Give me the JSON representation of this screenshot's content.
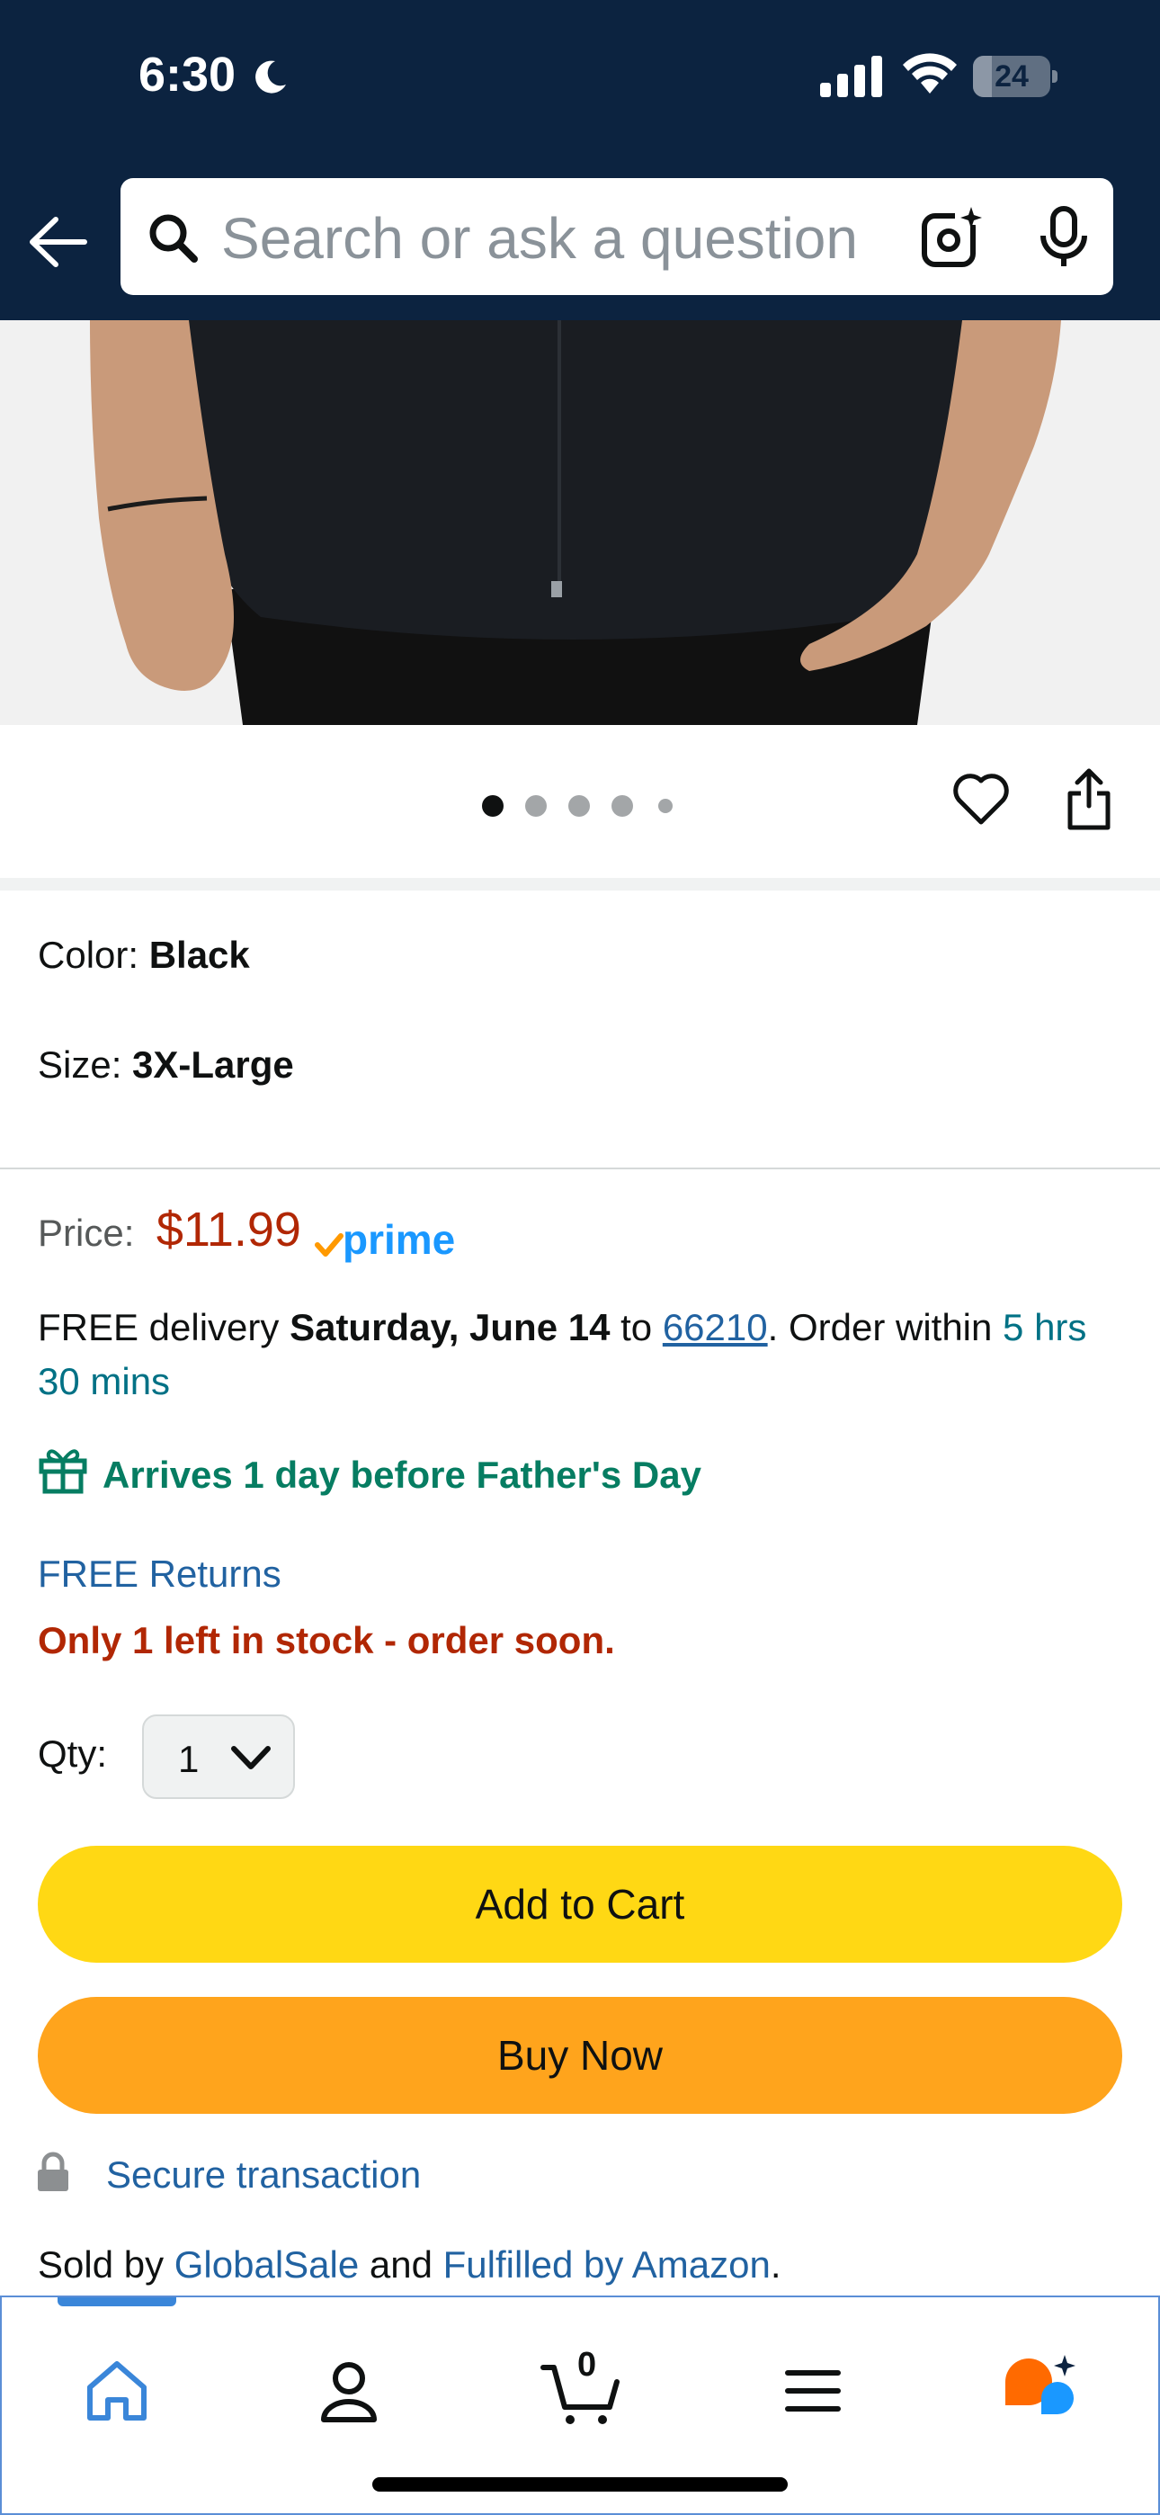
{
  "status_bar": {
    "time": "6:30",
    "battery": "24",
    "battery_level": 0.24
  },
  "search": {
    "placeholder": "Search or ask a question"
  },
  "gallery": {
    "image_count": 5,
    "current_index": 0
  },
  "variation": {
    "color_label": "Color: ",
    "color_value": "Black",
    "size_label": "Size: ",
    "size_value": "3X-Large"
  },
  "buybox": {
    "price_label": "Price:",
    "price": "$11.99",
    "prime_badge": "prime",
    "delivery_prefix": "FREE delivery ",
    "delivery_date": "Saturday, June 14",
    "delivery_to": " to ",
    "zip": "66210",
    "order_within": ". Order within ",
    "countdown": "5 hrs 30 mins",
    "fathers_day": "Arrives 1 day before Father's Day",
    "returns": "FREE Returns",
    "stock": "Only 1 left in stock - order soon.",
    "qty_label": "Qty:",
    "qty_value": "1",
    "add_to_cart": "Add to Cart",
    "buy_now": "Buy Now",
    "secure": "Secure transaction",
    "sold_by_prefix": "Sold by ",
    "seller": "GlobalSale",
    "and": " and ",
    "fulfilled": "Fulfilled by Amazon",
    "period": "."
  },
  "bottom_nav": {
    "items": [
      {
        "name": "home-icon",
        "active": true
      },
      {
        "name": "account-icon",
        "active": false
      },
      {
        "name": "cart-icon",
        "active": false
      },
      {
        "name": "menu-icon",
        "active": false
      },
      {
        "name": "rufus-icon",
        "active": false
      }
    ],
    "cart_count": "0"
  },
  "colors": {
    "header_bg": "#0c2340",
    "price": "#b12704",
    "link": "#2162a1",
    "teal": "#007185",
    "green": "#067d62",
    "add_to_cart": "#ffd814",
    "buy_now": "#ffa41c",
    "prime_blue": "#1a98ff",
    "prime_check": "#ff9900"
  }
}
